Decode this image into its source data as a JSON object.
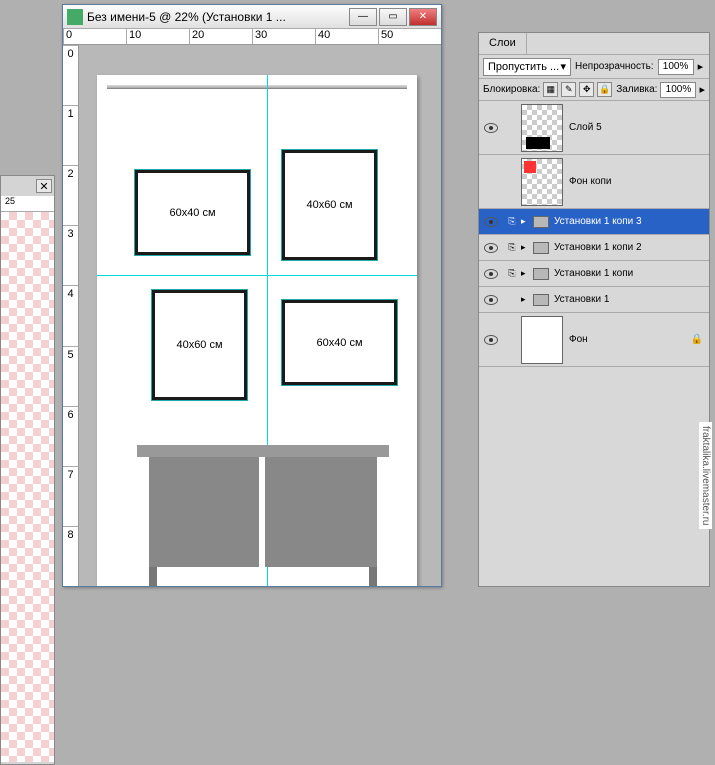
{
  "doc": {
    "title": "Без имени-5 @ 22% (Установки 1 ...",
    "ruler_top": [
      "0",
      "10",
      "20",
      "30",
      "40",
      "50"
    ],
    "ruler_left": [
      "0",
      "1",
      "2",
      "3",
      "4",
      "5",
      "6",
      "7",
      "8"
    ],
    "left_ruler": "25",
    "frames": [
      {
        "label": "60x40 см"
      },
      {
        "label": "40x60 см"
      },
      {
        "label": "40x60 см"
      },
      {
        "label": "60x40 см"
      }
    ]
  },
  "layers": {
    "tab": "Слои",
    "blend": "Пропустить ...",
    "opacity_label": "Непрозрачность:",
    "opacity_val": "100%",
    "lock_label": "Блокировка:",
    "fill_label": "Заливка:",
    "fill_val": "100%",
    "items": [
      {
        "name": "Слой 5",
        "visible": true,
        "thumb": "checker-black"
      },
      {
        "name": "Фон копи",
        "visible": false,
        "thumb": "checker-red"
      },
      {
        "name": "Установки 1 копи 3",
        "visible": true,
        "folder": true,
        "selected": true
      },
      {
        "name": "Установки 1 копи 2",
        "visible": true,
        "folder": true
      },
      {
        "name": "Установки 1 копи",
        "visible": true,
        "folder": true
      },
      {
        "name": "Установки 1",
        "visible": true,
        "folder": true
      },
      {
        "name": "Фон",
        "visible": true,
        "thumb": "white",
        "locked": true
      }
    ]
  },
  "watermark": "fraktalika.livemaster.ru"
}
